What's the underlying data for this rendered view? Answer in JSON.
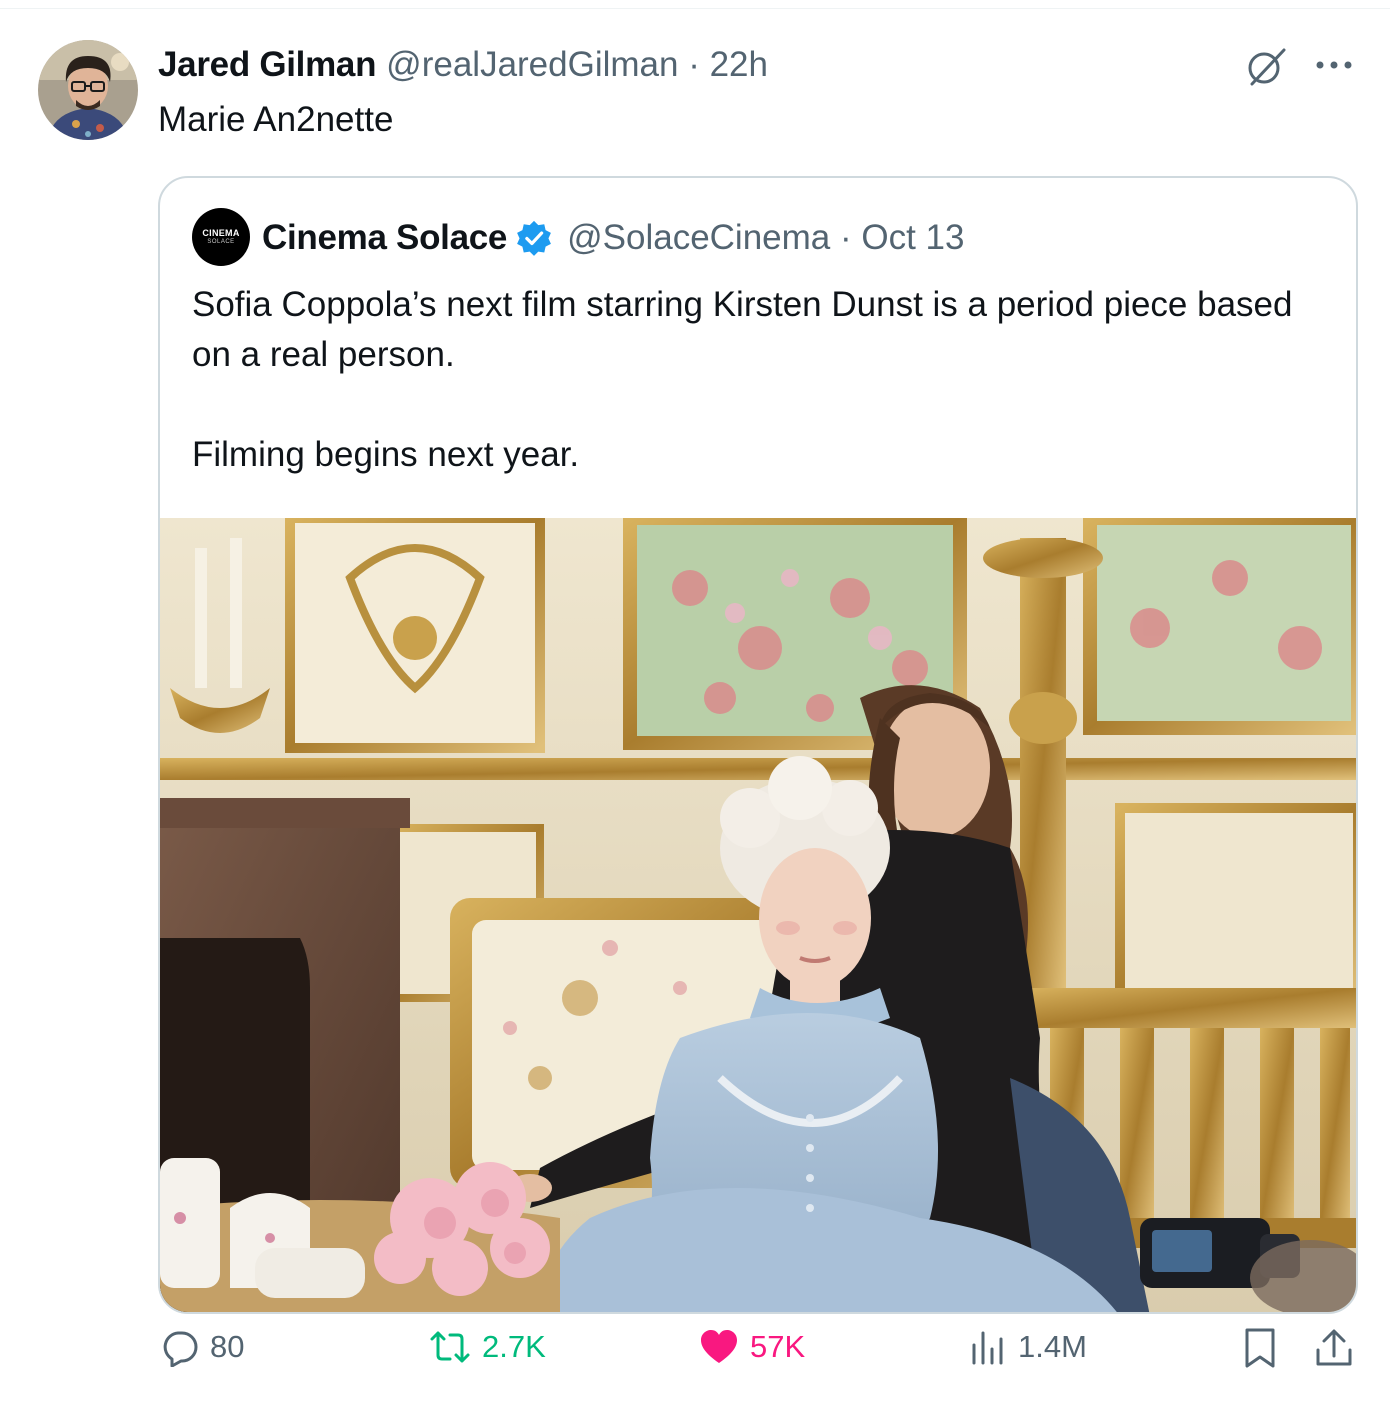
{
  "tweet": {
    "author_name": "Jared Gilman",
    "handle": "@realJaredGilman",
    "time": "22h",
    "text": "Marie An2nette"
  },
  "quoted": {
    "avatar_text": [
      "CINEMA",
      "SOLACE"
    ],
    "author_name": "Cinema Solace",
    "handle": "@SolaceCinema",
    "date": "Oct 13",
    "verified": true,
    "text": [
      "Sofia Coppola’s next film starring Kirsten Dunst is a period piece based on a real person.",
      "Filming begins next year."
    ]
  },
  "actions": {
    "replies": "80",
    "reposts": "2.7K",
    "likes": "57K",
    "views": "1.4M"
  },
  "icons": [
    "grok-icon",
    "more-icon",
    "reply-icon",
    "repost-icon",
    "like-icon",
    "views-icon",
    "bookmark-icon",
    "share-icon",
    "verified-badge-icon"
  ],
  "colors": {
    "text": "#0f1419",
    "secondary": "#536471",
    "border": "#cfd9de",
    "verified": "#1d9bf0",
    "repost": "#00ba7c",
    "like": "#f91880"
  }
}
